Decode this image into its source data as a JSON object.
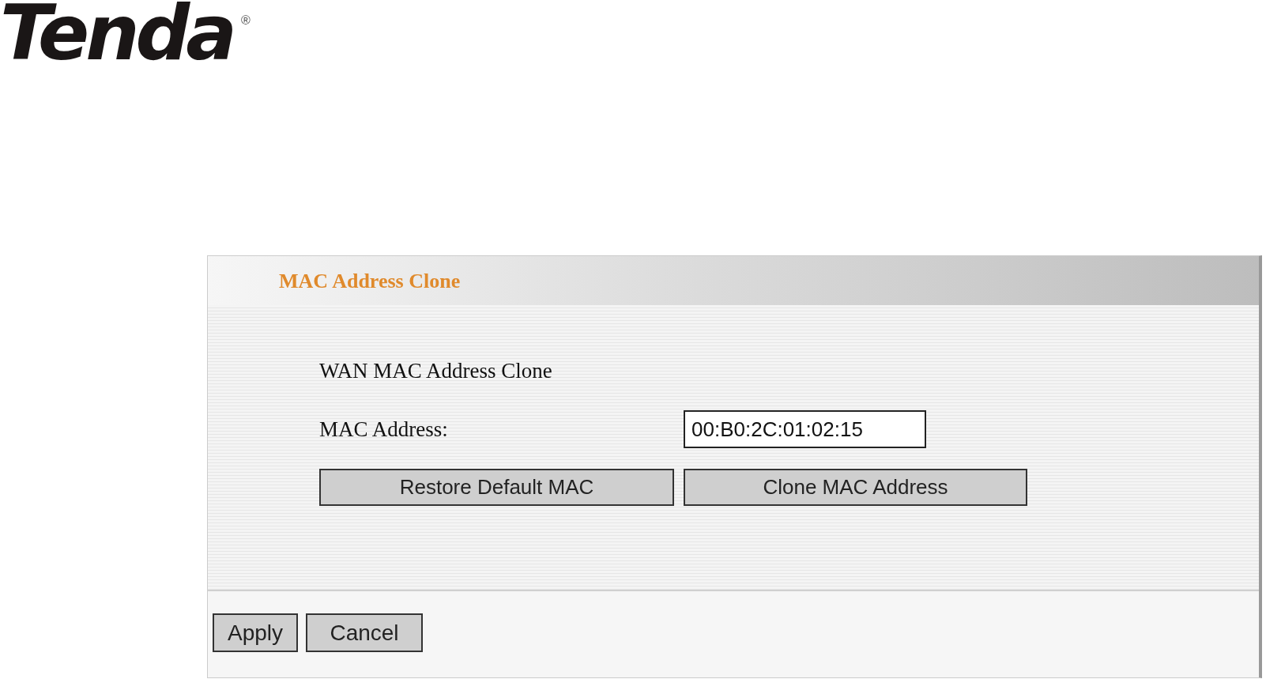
{
  "logo": {
    "text": "Tenda",
    "mark": "®"
  },
  "panel": {
    "title": "MAC Address Clone",
    "section": "WAN MAC Address Clone",
    "mac_field": {
      "label": "MAC Address:",
      "value": "00:B0:2C:01:02:15"
    },
    "buttons": [
      "Restore Default MAC",
      "Clone MAC Address"
    ]
  },
  "footer_buttons": [
    "Apply",
    "Cancel"
  ]
}
